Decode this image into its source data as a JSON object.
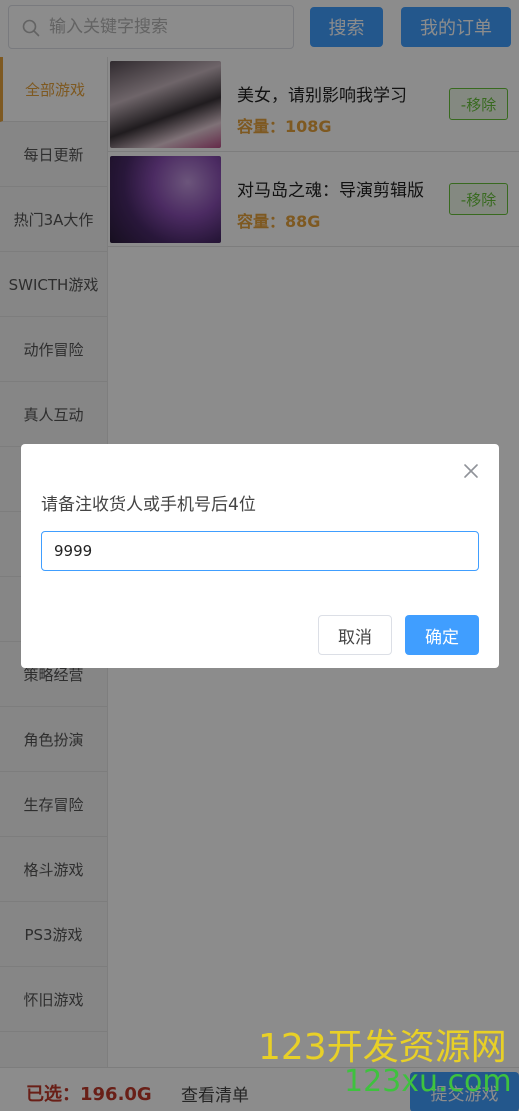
{
  "search": {
    "placeholder": "输入关键字搜索",
    "button_label": "搜索",
    "icon": "search-icon"
  },
  "header": {
    "orders_label": "我的订单"
  },
  "sidebar": {
    "items": [
      {
        "label": "全部游戏",
        "active": true
      },
      {
        "label": "每日更新"
      },
      {
        "label": "热门3A大作"
      },
      {
        "label": "SWICTH游戏"
      },
      {
        "label": "动作冒险"
      },
      {
        "label": "真人互动"
      },
      {
        "label": ""
      },
      {
        "label": ""
      },
      {
        "label": ""
      },
      {
        "label": "策略经营"
      },
      {
        "label": "角色扮演"
      },
      {
        "label": "生存冒险"
      },
      {
        "label": "格斗游戏"
      },
      {
        "label": "PS3游戏"
      },
      {
        "label": "怀旧游戏"
      }
    ]
  },
  "games": [
    {
      "title": "美女，请别影响我学习",
      "size": "容量：108G",
      "remove_label": "-移除"
    },
    {
      "title": "对马岛之魂：导演剪辑版",
      "size": "容量：88G",
      "remove_label": "-移除"
    }
  ],
  "footer": {
    "selected": "已选：196.0G",
    "view_list": "查看清单",
    "submit": "提交游戏"
  },
  "dialog": {
    "title": "请备注收货人或手机号后4位",
    "input_value": "9999",
    "cancel_label": "取消",
    "confirm_label": "确定",
    "close_icon": "close-icon"
  },
  "watermark": {
    "line1": "123开发资源网",
    "line2": "123xu.com"
  },
  "colors": {
    "accent": "#409eff",
    "active": "#e6a23c",
    "remove": "#67c23a",
    "selected_total": "#c0392b"
  }
}
